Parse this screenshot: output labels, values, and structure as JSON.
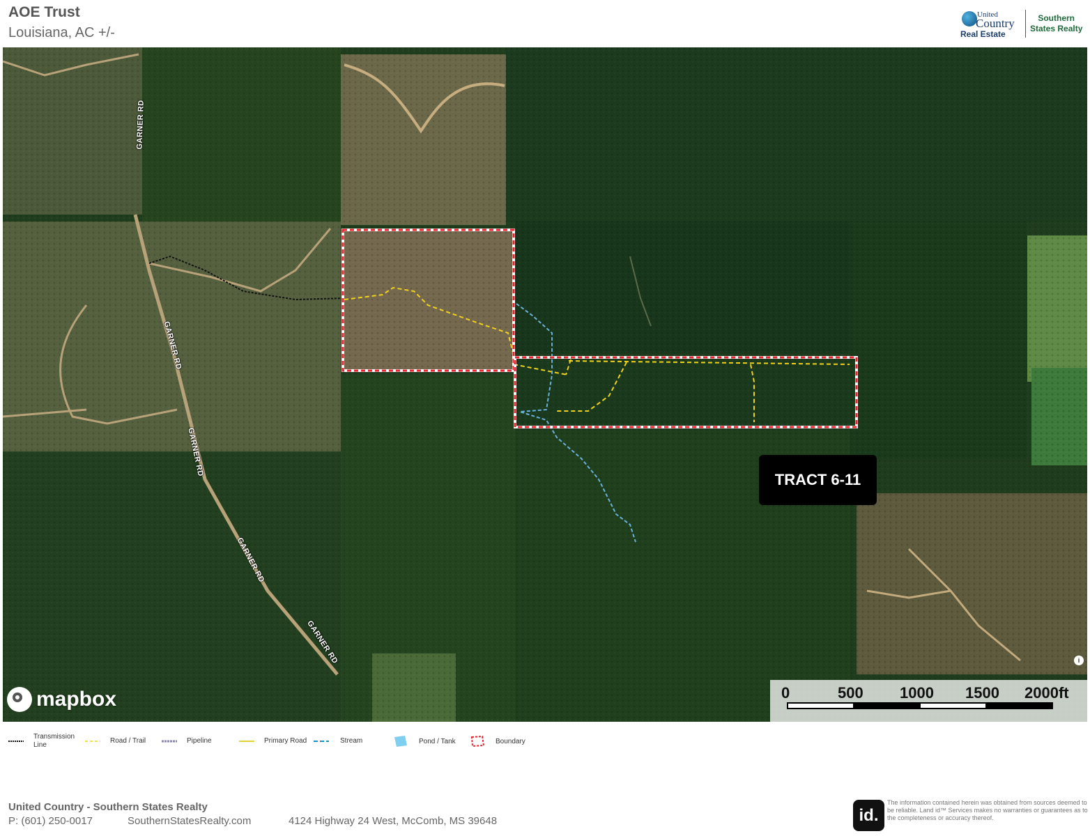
{
  "header": {
    "title": "AOE Trust",
    "subtitle": "Louisiana,  AC +/-"
  },
  "logo": {
    "united": "United",
    "country": "Country",
    "real_estate": "Real Estate",
    "southern": "Southern",
    "states_realty": "States Realty"
  },
  "map": {
    "tract_label": "TRACT 6-11",
    "road_name": "GARNER RD",
    "attribution": "mapbox",
    "info_icon": "i",
    "boundary_color": "#e8222e",
    "stream_color": "#5aa9d6",
    "road_color": "#f1d21c",
    "transmission_color": "#111111"
  },
  "scale": {
    "labels": [
      "0",
      "500",
      "1000",
      "1500",
      "2000ft"
    ]
  },
  "legend": {
    "items": [
      {
        "label": "Transmission Line",
        "symbol": "transmission-line-icon"
      },
      {
        "label": "Road / Trail",
        "symbol": "road-trail-icon"
      },
      {
        "label": "Pipeline",
        "symbol": "pipeline-icon"
      },
      {
        "label": "Primary Road",
        "symbol": "primary-road-icon"
      },
      {
        "label": "Stream",
        "symbol": "stream-icon"
      },
      {
        "label": "Pond / Tank",
        "symbol": "pond-tank-icon"
      },
      {
        "label": "Boundary",
        "symbol": "boundary-icon"
      }
    ]
  },
  "footer": {
    "company": "United Country - Southern States Realty",
    "phone": "P: (601) 250-0017",
    "website": "SouthernStatesRealty.com",
    "address": "4124 Highway 24 West, McComb, MS 39648",
    "id_logo": "id.",
    "disclaimer": "The information contained herein was obtained from sources deemed to be reliable. Land id™ Services makes no warranties or guarantees as to the completeness or accuracy thereof."
  }
}
